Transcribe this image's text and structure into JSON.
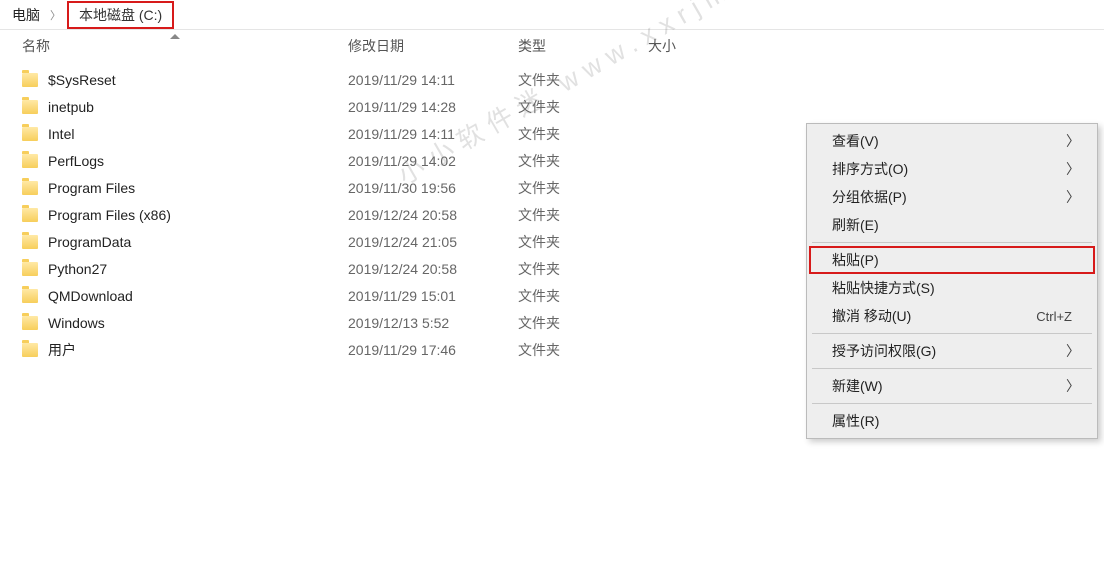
{
  "breadcrumb": {
    "item1": "电脑",
    "item2": "本地磁盘 (C:)"
  },
  "columns": {
    "name": "名称",
    "date": "修改日期",
    "type": "类型",
    "size": "大小"
  },
  "files": [
    {
      "name": "$SysReset",
      "date": "2019/11/29 14:11",
      "type": "文件夹"
    },
    {
      "name": "inetpub",
      "date": "2019/11/29 14:28",
      "type": "文件夹"
    },
    {
      "name": "Intel",
      "date": "2019/11/29 14:11",
      "type": "文件夹"
    },
    {
      "name": "PerfLogs",
      "date": "2019/11/29 14:02",
      "type": "文件夹"
    },
    {
      "name": "Program Files",
      "date": "2019/11/30 19:56",
      "type": "文件夹"
    },
    {
      "name": "Program Files (x86)",
      "date": "2019/12/24 20:58",
      "type": "文件夹"
    },
    {
      "name": "ProgramData",
      "date": "2019/12/24 21:05",
      "type": "文件夹"
    },
    {
      "name": "Python27",
      "date": "2019/12/24 20:58",
      "type": "文件夹"
    },
    {
      "name": "QMDownload",
      "date": "2019/11/29 15:01",
      "type": "文件夹"
    },
    {
      "name": "Windows",
      "date": "2019/12/13 5:52",
      "type": "文件夹"
    },
    {
      "name": "用户",
      "date": "2019/11/29 17:46",
      "type": "文件夹"
    }
  ],
  "menu": {
    "view": "查看(V)",
    "sort": "排序方式(O)",
    "group": "分组依据(P)",
    "refresh": "刷新(E)",
    "paste": "粘贴(P)",
    "paste_shortcut": "粘贴快捷方式(S)",
    "undo": "撤消 移动(U)",
    "undo_key": "Ctrl+Z",
    "access": "授予访问权限(G)",
    "new": "新建(W)",
    "properties": "属性(R)"
  },
  "watermark": "小小软件迷 www.xxrjm.com"
}
